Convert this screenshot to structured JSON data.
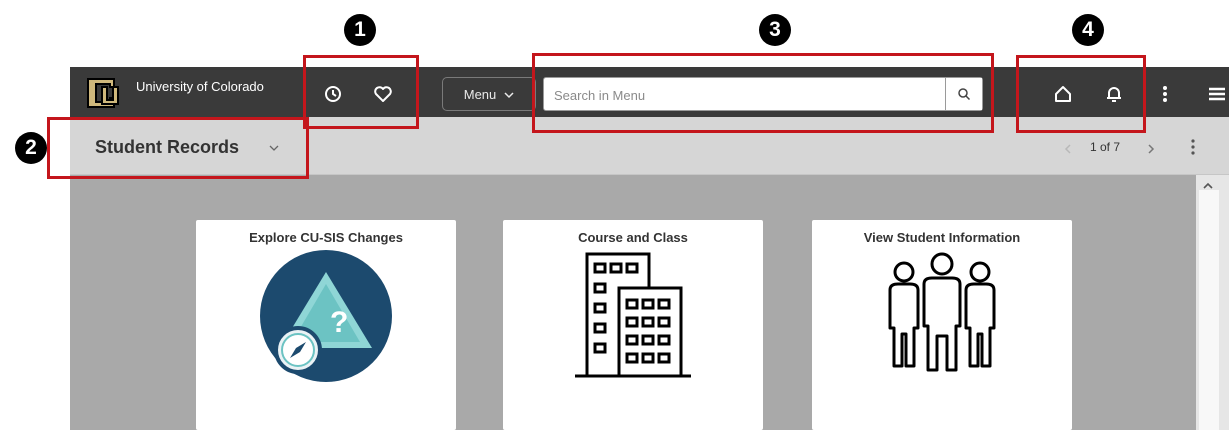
{
  "header": {
    "university_name": "University of Colorado",
    "recent_icon": "clock-icon",
    "favorites_icon": "heart-icon",
    "menu_label": "Menu",
    "search_placeholder": "Search in Menu",
    "home_icon": "home-icon",
    "notifications_icon": "bell-icon",
    "actions_icon": "vertical-ellipsis-icon",
    "navbar_icon": "hamburger-icon"
  },
  "subheader": {
    "title": "Student Records",
    "pager": "1 of 7"
  },
  "tiles": [
    {
      "title": "Explore CU-SIS Changes",
      "icon": "compass-warning-icon"
    },
    {
      "title": "Course and Class",
      "icon": "buildings-icon"
    },
    {
      "title": "View Student Information",
      "icon": "people-icon"
    }
  ],
  "callouts": [
    "1",
    "2",
    "3",
    "4"
  ],
  "colors": {
    "header_bg": "#3a3a3a",
    "subheader_bg": "#d6d6d6",
    "content_bg": "#a9a9a9",
    "callout_red": "#c4161c",
    "brand_gold": "#cfb87c"
  }
}
